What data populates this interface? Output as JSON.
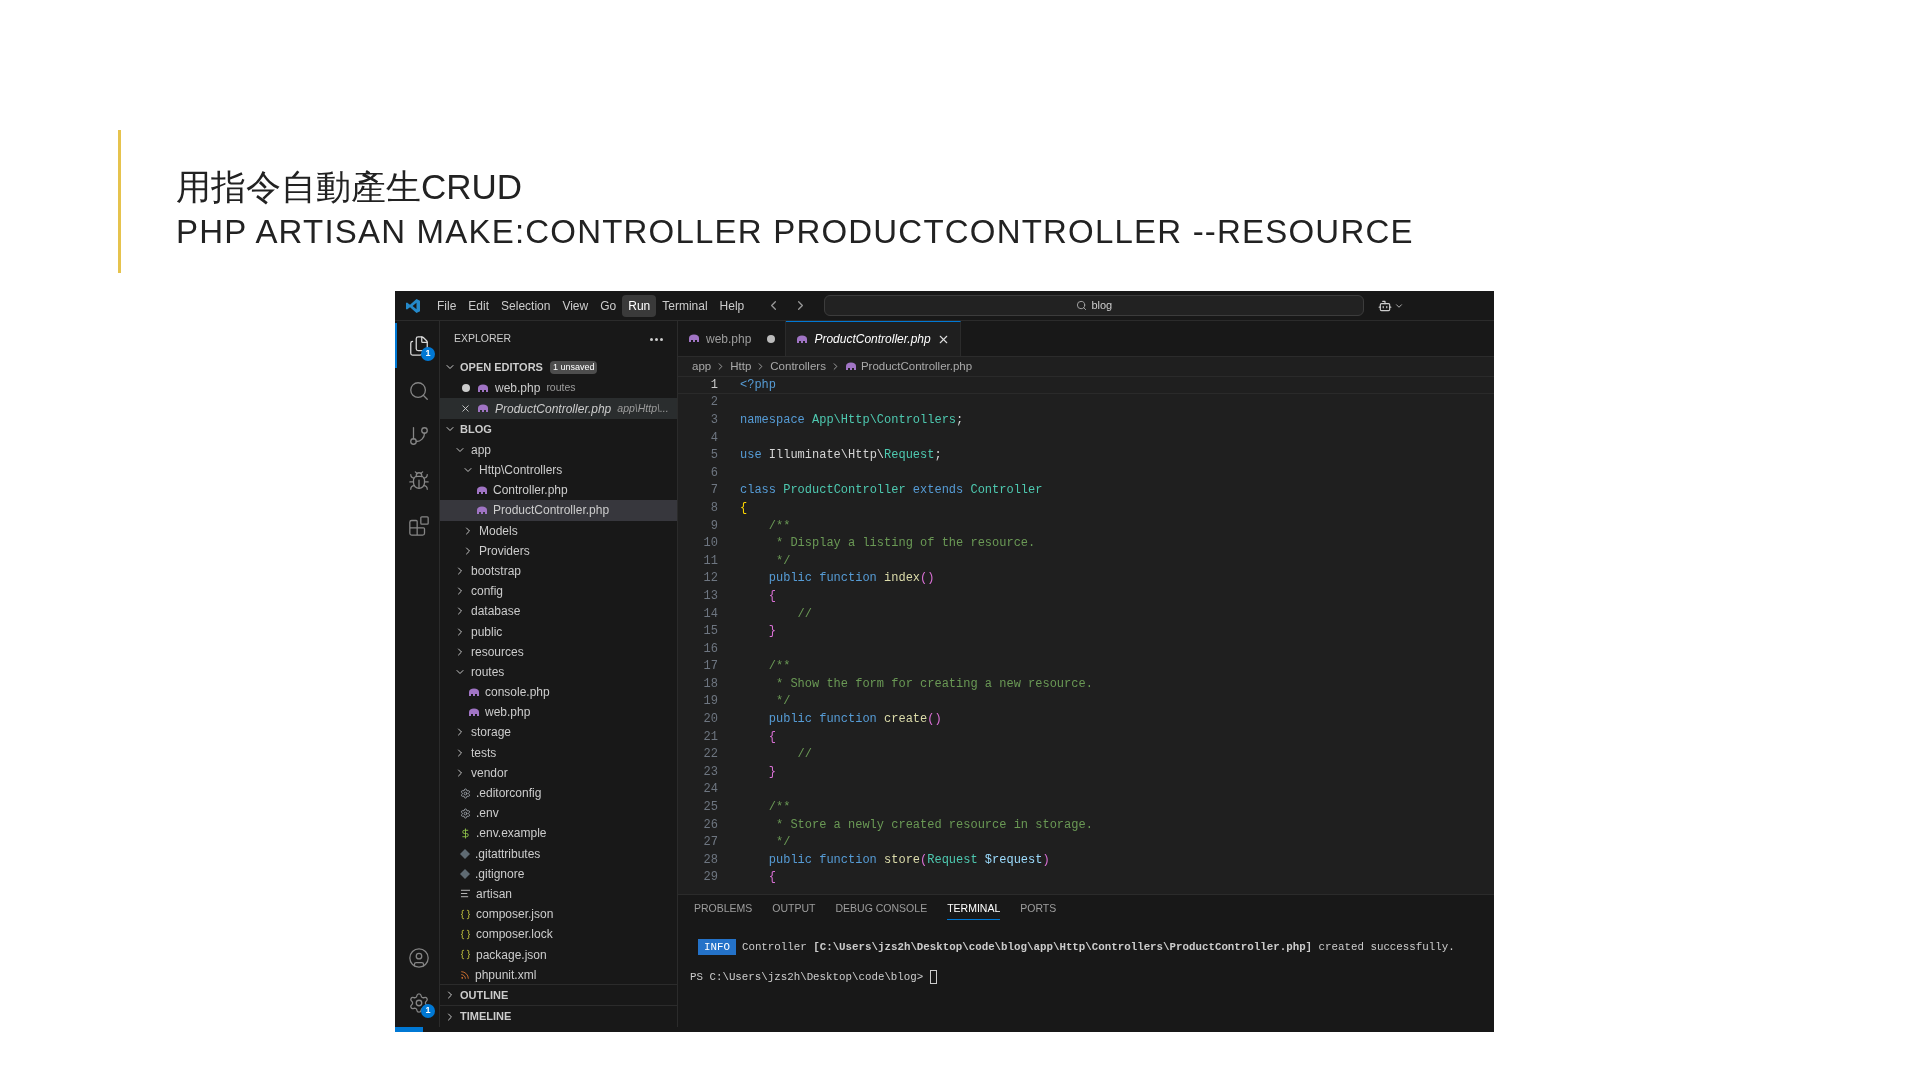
{
  "slide": {
    "title": "用指令自動產生CRUD",
    "subtitle": "PHP ARTISAN MAKE:CONTROLLER PRODUCTCONTROLLER --RESOURCE"
  },
  "menu": [
    {
      "label": "File",
      "selected": false
    },
    {
      "label": "Edit",
      "selected": false
    },
    {
      "label": "Selection",
      "selected": false
    },
    {
      "label": "View",
      "selected": false
    },
    {
      "label": "Go",
      "selected": false
    },
    {
      "label": "Run",
      "selected": true
    },
    {
      "label": "Terminal",
      "selected": false
    },
    {
      "label": "Help",
      "selected": false
    }
  ],
  "search": {
    "value": "blog"
  },
  "activity": [
    {
      "kind": "files",
      "selected": true,
      "badge": "1"
    },
    {
      "kind": "search",
      "selected": false
    },
    {
      "kind": "git",
      "selected": false
    },
    {
      "kind": "debug",
      "selected": false
    },
    {
      "kind": "extensions",
      "selected": false
    }
  ],
  "activity_bottom": [
    {
      "kind": "account"
    },
    {
      "kind": "settings",
      "badge": "1"
    }
  ],
  "explorer": {
    "title": "EXPLORER"
  },
  "open_editors": {
    "title": "OPEN EDITORS",
    "badge": "1 unsaved",
    "expanded": true,
    "items": [
      {
        "label": "web.php",
        "description": "routes",
        "modified": true,
        "selected": false,
        "preview": false
      },
      {
        "label": "ProductController.php",
        "description": "app\\Http\\...",
        "modified": false,
        "selected": true,
        "preview": true
      }
    ]
  },
  "folder": {
    "title": "BLOG",
    "expanded": true,
    "tree": [
      {
        "label": "app",
        "kind": "folder",
        "expanded": true,
        "selected": false,
        "children": [
          {
            "label": "Http\\Controllers",
            "kind": "folder",
            "expanded": true,
            "selected": false,
            "children": [
              {
                "label": "Controller.php",
                "kind": "php",
                "selected": false
              },
              {
                "label": "ProductController.php",
                "kind": "php",
                "selected": true
              }
            ]
          },
          {
            "label": "Models",
            "kind": "folder",
            "expanded": false,
            "selected": false
          },
          {
            "label": "Providers",
            "kind": "folder",
            "expanded": false,
            "selected": false
          }
        ]
      },
      {
        "label": "bootstrap",
        "kind": "folder",
        "expanded": false,
        "selected": false
      },
      {
        "label": "config",
        "kind": "folder",
        "expanded": false,
        "selected": false
      },
      {
        "label": "database",
        "kind": "folder",
        "expanded": false,
        "selected": false
      },
      {
        "label": "public",
        "kind": "folder",
        "expanded": false,
        "selected": false
      },
      {
        "label": "resources",
        "kind": "folder",
        "expanded": false,
        "selected": false
      },
      {
        "label": "routes",
        "kind": "folder",
        "expanded": true,
        "selected": false,
        "children": [
          {
            "label": "console.php",
            "kind": "php",
            "selected": false
          },
          {
            "label": "web.php",
            "kind": "php",
            "selected": false
          }
        ]
      },
      {
        "label": "storage",
        "kind": "folder",
        "expanded": false,
        "selected": false
      },
      {
        "label": "tests",
        "kind": "folder",
        "expanded": false,
        "selected": false
      },
      {
        "label": "vendor",
        "kind": "folder",
        "expanded": false,
        "selected": false
      },
      {
        "label": ".editorconfig",
        "kind": "gear",
        "selected": false
      },
      {
        "label": ".env",
        "kind": "gear",
        "selected": false
      },
      {
        "label": ".env.example",
        "kind": "dollar",
        "selected": false
      },
      {
        "label": ".gitattributes",
        "kind": "git",
        "selected": false
      },
      {
        "label": ".gitignore",
        "kind": "git",
        "selected": false
      },
      {
        "label": "artisan",
        "kind": "lines",
        "selected": false
      },
      {
        "label": "composer.json",
        "kind": "braces",
        "selected": false
      },
      {
        "label": "composer.lock",
        "kind": "braces",
        "selected": false
      },
      {
        "label": "package.json",
        "kind": "braces",
        "selected": false
      },
      {
        "label": "phpunit.xml",
        "kind": "rss",
        "selected": false
      }
    ]
  },
  "outline": {
    "title": "OUTLINE",
    "expanded": false
  },
  "timeline": {
    "title": "TIMELINE",
    "expanded": false
  },
  "tabs": [
    {
      "label": "web.php",
      "selected": false,
      "modified": true,
      "preview": false
    },
    {
      "label": "ProductController.php",
      "selected": true,
      "modified": false,
      "preview": true
    }
  ],
  "breadcrumb": [
    "app",
    "Http",
    "Controllers",
    "ProductController.php"
  ],
  "code": [
    {
      "number": "1",
      "current": true,
      "tokens": [
        {
          "kind": "tag",
          "text": "<?php"
        }
      ]
    },
    {
      "number": "2",
      "current": false
    },
    {
      "number": "3",
      "current": false,
      "tokens": [
        {
          "kind": "kw",
          "text": "namespace "
        },
        {
          "kind": "type",
          "text": "App\\Http\\Controllers"
        },
        {
          "kind": "plain",
          "text": ";"
        }
      ]
    },
    {
      "number": "4",
      "current": false
    },
    {
      "number": "5",
      "current": false,
      "tokens": [
        {
          "kind": "kw",
          "text": "use "
        },
        {
          "kind": "plain",
          "text": "Illuminate\\Http\\"
        },
        {
          "kind": "type",
          "text": "Request"
        },
        {
          "kind": "plain",
          "text": ";"
        }
      ]
    },
    {
      "number": "6",
      "current": false
    },
    {
      "number": "7",
      "current": false,
      "tokens": [
        {
          "kind": "kw",
          "text": "class "
        },
        {
          "kind": "type",
          "text": "ProductController "
        },
        {
          "kind": "kw",
          "text": "extends "
        },
        {
          "kind": "type",
          "text": "Controller"
        }
      ]
    },
    {
      "number": "8",
      "current": false,
      "tokens": [
        {
          "kind": "brace1",
          "text": "{"
        }
      ]
    },
    {
      "number": "9",
      "current": false,
      "tokens": [
        {
          "kind": "comment",
          "text": "    /**"
        }
      ]
    },
    {
      "number": "10",
      "current": false,
      "tokens": [
        {
          "kind": "comment",
          "text": "     * Display a listing of the resource."
        }
      ]
    },
    {
      "number": "11",
      "current": false,
      "tokens": [
        {
          "kind": "comment",
          "text": "     */"
        }
      ]
    },
    {
      "number": "12",
      "current": false,
      "tokens": [
        {
          "kind": "kw",
          "text": "    public function "
        },
        {
          "kind": "fn",
          "text": "index"
        },
        {
          "kind": "brace2",
          "text": "()"
        }
      ]
    },
    {
      "number": "13",
      "current": false,
      "tokens": [
        {
          "kind": "brace2",
          "text": "    {"
        }
      ]
    },
    {
      "number": "14",
      "current": false,
      "tokens": [
        {
          "kind": "comment",
          "text": "        //"
        }
      ]
    },
    {
      "number": "15",
      "current": false,
      "tokens": [
        {
          "kind": "brace2",
          "text": "    }"
        }
      ]
    },
    {
      "number": "16",
      "current": false
    },
    {
      "number": "17",
      "current": false,
      "tokens": [
        {
          "kind": "comment",
          "text": "    /**"
        }
      ]
    },
    {
      "number": "18",
      "current": false,
      "tokens": [
        {
          "kind": "comment",
          "text": "     * Show the form for creating a new resource."
        }
      ]
    },
    {
      "number": "19",
      "current": false,
      "tokens": [
        {
          "kind": "comment",
          "text": "     */"
        }
      ]
    },
    {
      "number": "20",
      "current": false,
      "tokens": [
        {
          "kind": "kw",
          "text": "    public function "
        },
        {
          "kind": "fn",
          "text": "create"
        },
        {
          "kind": "brace2",
          "text": "()"
        }
      ]
    },
    {
      "number": "21",
      "current": false,
      "tokens": [
        {
          "kind": "brace2",
          "text": "    {"
        }
      ]
    },
    {
      "number": "22",
      "current": false,
      "tokens": [
        {
          "kind": "comment",
          "text": "        //"
        }
      ]
    },
    {
      "number": "23",
      "current": false,
      "tokens": [
        {
          "kind": "brace2",
          "text": "    }"
        }
      ]
    },
    {
      "number": "24",
      "current": false
    },
    {
      "number": "25",
      "current": false,
      "tokens": [
        {
          "kind": "comment",
          "text": "    /**"
        }
      ]
    },
    {
      "number": "26",
      "current": false,
      "tokens": [
        {
          "kind": "comment",
          "text": "     * Store a newly created resource in storage."
        }
      ]
    },
    {
      "number": "27",
      "current": false,
      "tokens": [
        {
          "kind": "comment",
          "text": "     */"
        }
      ]
    },
    {
      "number": "28",
      "current": false,
      "tokens": [
        {
          "kind": "kw",
          "text": "    public function "
        },
        {
          "kind": "fn",
          "text": "store"
        },
        {
          "kind": "brace2",
          "text": "("
        },
        {
          "kind": "type",
          "text": "Request "
        },
        {
          "kind": "var",
          "text": "$request"
        },
        {
          "kind": "brace2",
          "text": ")"
        }
      ]
    },
    {
      "number": "29",
      "current": false,
      "tokens": [
        {
          "kind": "brace2",
          "text": "    {"
        }
      ]
    }
  ],
  "panel_tabs": [
    {
      "label": "PROBLEMS",
      "selected": false
    },
    {
      "label": "OUTPUT",
      "selected": false
    },
    {
      "label": "DEBUG CONSOLE",
      "selected": false
    },
    {
      "label": "TERMINAL",
      "selected": true
    },
    {
      "label": "PORTS",
      "selected": false
    }
  ],
  "terminal": {
    "badge": "INFO",
    "message": "Controller **[C:\\Users\\jzs2h\\Desktop\\code\\blog\\app\\Http\\Controllers\\ProductController.php]** created successfully.",
    "prompt": "PS C:\\Users\\jzs2h\\Desktop\\code\\blog> "
  }
}
